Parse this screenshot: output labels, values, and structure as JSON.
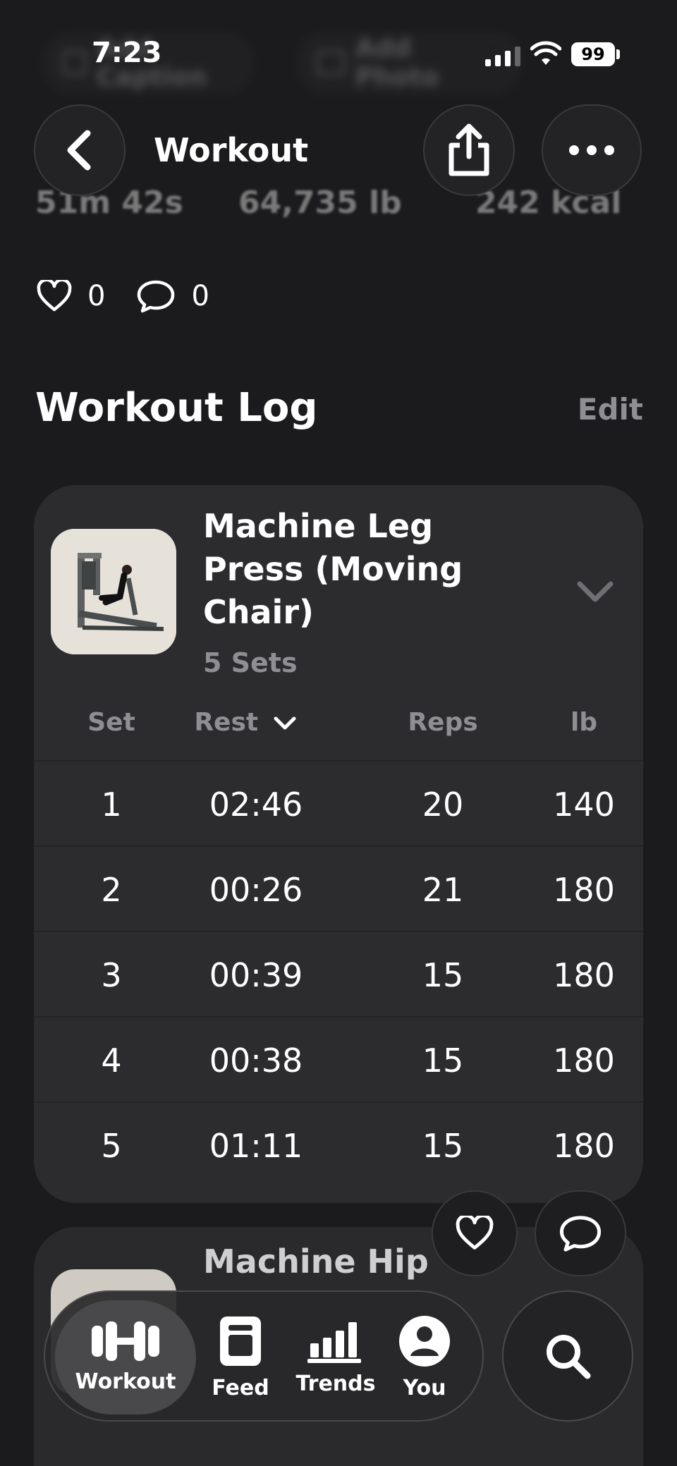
{
  "status_bar": {
    "time": "7:23",
    "battery": "99"
  },
  "background_actions": {
    "caption_label": "Add Caption",
    "photo_label": "Add Photo"
  },
  "nav": {
    "title": "Workout"
  },
  "stats": {
    "duration": "51m 42s",
    "volume": "64,735 lb",
    "calories": "242 kcal"
  },
  "social": {
    "likes": "0",
    "comments": "0"
  },
  "section": {
    "title": "Workout Log",
    "edit_label": "Edit"
  },
  "exercise1": {
    "name": "Machine Leg Press (Moving Chair)",
    "sets_label": "5 Sets",
    "columns": {
      "set": "Set",
      "rest": "Rest",
      "reps": "Reps",
      "weight": "lb"
    },
    "rows": [
      {
        "set": "1",
        "rest": "02:46",
        "reps": "20",
        "weight": "140"
      },
      {
        "set": "2",
        "rest": "00:26",
        "reps": "21",
        "weight": "180"
      },
      {
        "set": "3",
        "rest": "00:39",
        "reps": "15",
        "weight": "180"
      },
      {
        "set": "4",
        "rest": "00:38",
        "reps": "15",
        "weight": "180"
      },
      {
        "set": "5",
        "rest": "01:11",
        "reps": "15",
        "weight": "180"
      }
    ]
  },
  "exercise2": {
    "name": "Machine Hip"
  },
  "tabbar": {
    "active": "Workout",
    "items": [
      {
        "label": "Workout",
        "icon": "dumbbell-icon"
      },
      {
        "label": "Feed",
        "icon": "feed-icon"
      },
      {
        "label": "Trends",
        "icon": "bar-chart-icon"
      },
      {
        "label": "You",
        "icon": "person-icon"
      }
    ]
  },
  "colors": {
    "background": "#1b1b1d",
    "card": "#2c2c2e",
    "secondary_text": "#8e8e93"
  }
}
